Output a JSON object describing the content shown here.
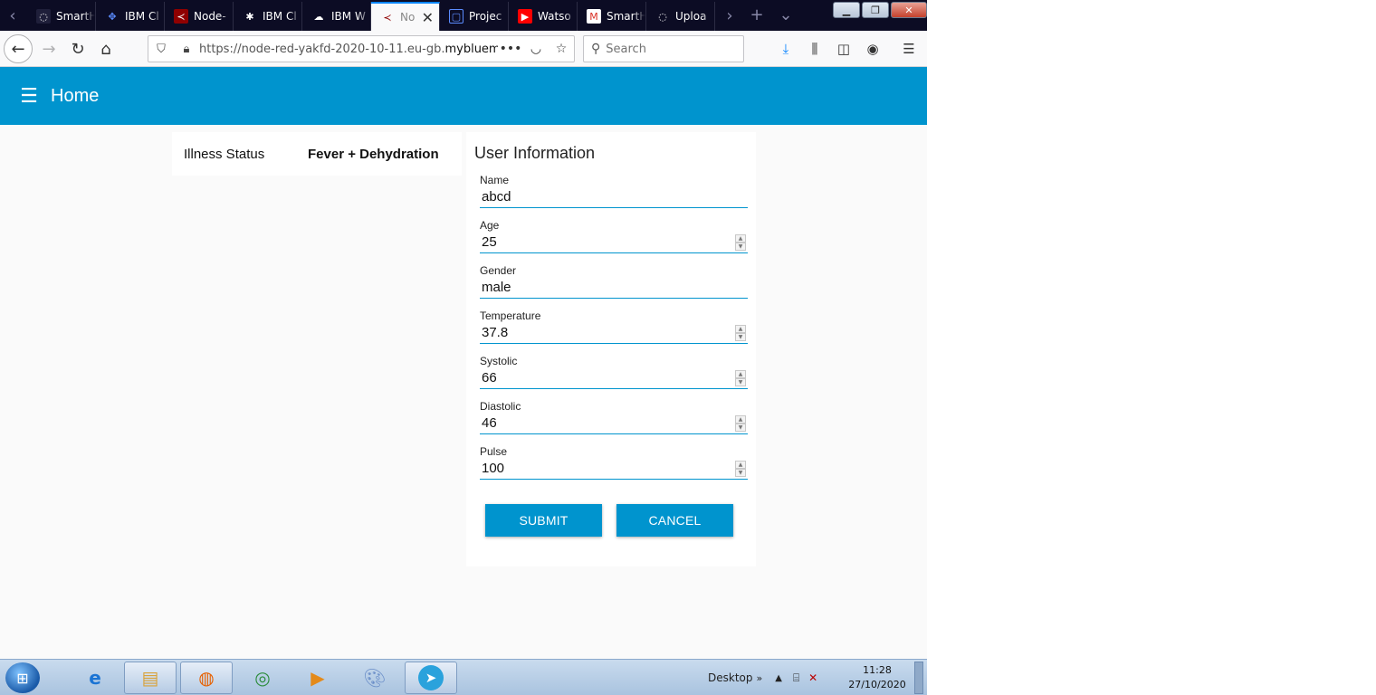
{
  "browser": {
    "tabs": [
      {
        "label": "SmartH",
        "icon": "ibm-cloud-icon",
        "color": "#1f1f3a"
      },
      {
        "label": "IBM Cl",
        "icon": "ibm-cloud-icon",
        "color": "#2d5fd4"
      },
      {
        "label": "Node-",
        "icon": "node-red-icon",
        "color": "#8f0000"
      },
      {
        "label": "IBM Cl",
        "icon": "ibm-watson-icon",
        "color": "#1f1f3a"
      },
      {
        "label": "IBM W",
        "icon": "ibm-watson-icon",
        "color": "#1f1f3a"
      },
      {
        "label": "No",
        "icon": "node-red-icon",
        "color": "#8f0000",
        "active": true
      },
      {
        "label": "Projec",
        "icon": "project-icon",
        "color": "#2d5fd4"
      },
      {
        "label": "Watso",
        "icon": "youtube-icon",
        "color": "#ff0000"
      },
      {
        "label": "SmartH",
        "icon": "gmail-icon",
        "color": "#d93025"
      },
      {
        "label": "Uploa",
        "icon": "upload-icon",
        "color": "#1f1f3a"
      }
    ],
    "url_prefix": "https://node-red-yakfd-2020-10-11.eu-gb.",
    "url_domain": "mybluem",
    "search_placeholder": "Search"
  },
  "app": {
    "title": "Home",
    "status": {
      "label": "Illness Status",
      "value": "Fever + Dehydration"
    },
    "form": {
      "title": "User Information",
      "fields": [
        {
          "label": "Name",
          "value": "abcd",
          "type": "text"
        },
        {
          "label": "Age",
          "value": "25",
          "type": "number"
        },
        {
          "label": "Gender",
          "value": "male",
          "type": "text"
        },
        {
          "label": "Temperature",
          "value": "37.8",
          "type": "number"
        },
        {
          "label": "Systolic",
          "value": "66",
          "type": "number"
        },
        {
          "label": "Diastolic",
          "value": "46",
          "type": "number"
        },
        {
          "label": "Pulse",
          "value": "100",
          "type": "number"
        }
      ],
      "submit_label": "SUBMIT",
      "cancel_label": "CANCEL"
    }
  },
  "taskbar": {
    "desktop_label": "Desktop",
    "time": "11:28",
    "date": "27/10/2020"
  },
  "colors": {
    "accent": "#0094ce",
    "tabbar": "#0c0c24"
  }
}
